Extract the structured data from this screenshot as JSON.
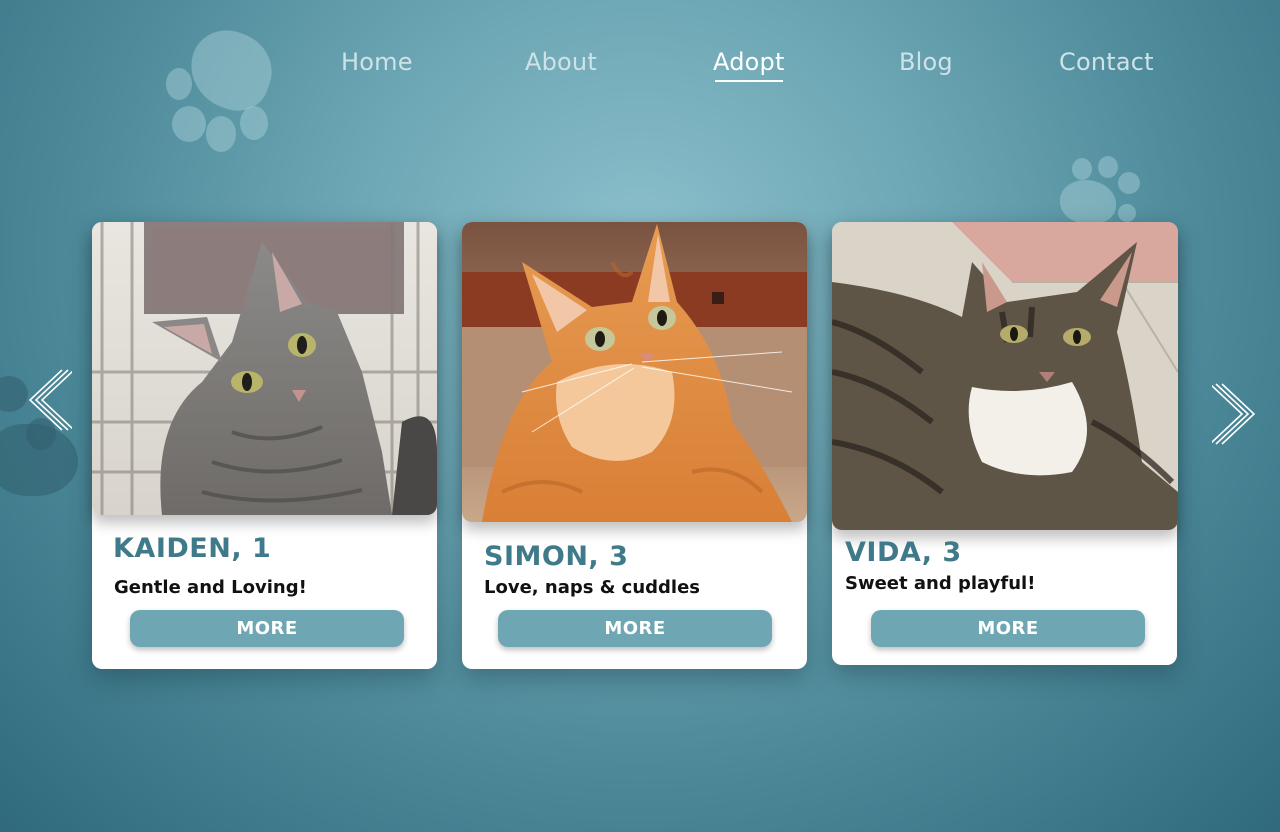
{
  "nav": {
    "items": [
      {
        "label": "Home"
      },
      {
        "label": "About"
      },
      {
        "label": "Adopt",
        "active": true
      },
      {
        "label": "Blog"
      },
      {
        "label": "Contact"
      }
    ]
  },
  "carousel": {
    "prev_icon": "double-chevron-left-icon",
    "next_icon": "double-chevron-right-icon",
    "cards": [
      {
        "name": "KAIDEN, 1",
        "description": "Gentle and Loving!",
        "button": "MORE",
        "photo": "gray-tabby-cat-photo"
      },
      {
        "name": "SIMON, 3",
        "description": "Love, naps & cuddles",
        "button": "MORE",
        "photo": "orange-tabby-cat-photo"
      },
      {
        "name": "VIDA, 3",
        "description": "Sweet and playful!",
        "button": "MORE",
        "photo": "brown-tabby-white-cat-photo"
      }
    ]
  },
  "colors": {
    "background_center": "#8cc0cc",
    "background_edge": "#2f6a7c",
    "accent": "#3f7a8a",
    "button": "#6ea7b3"
  }
}
